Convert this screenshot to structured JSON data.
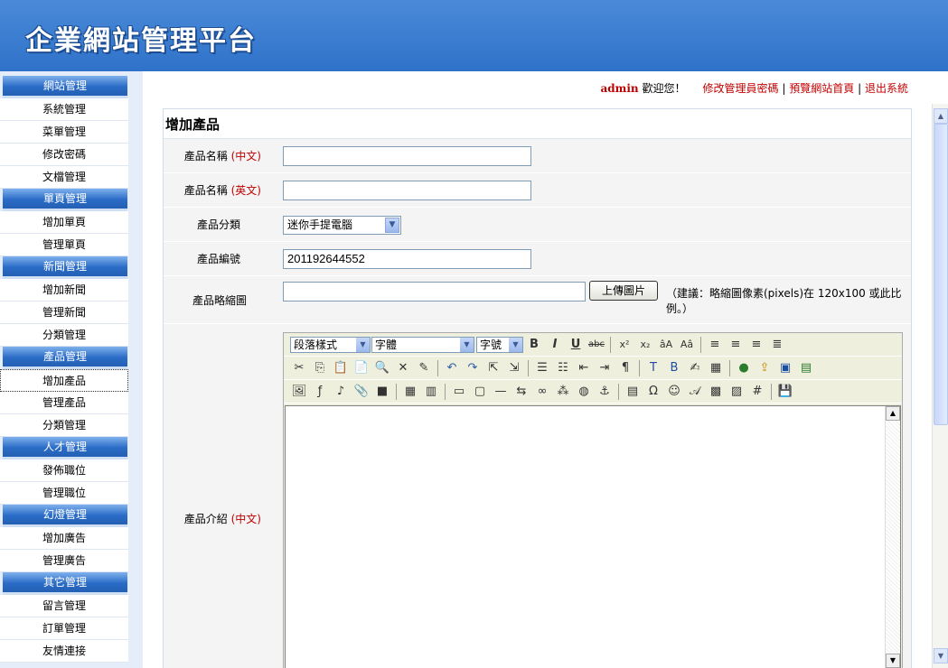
{
  "header": {
    "title": "企業網站管理平台"
  },
  "sidebar": {
    "groups": [
      {
        "head": "網站管理",
        "items": [
          "系統管理",
          "菜單管理",
          "修改密碼",
          "文檔管理"
        ]
      },
      {
        "head": "單頁管理",
        "items": [
          "增加單頁",
          "管理單頁"
        ]
      },
      {
        "head": "新聞管理",
        "items": [
          "增加新聞",
          "管理新聞",
          "分類管理"
        ]
      },
      {
        "head": "產品管理",
        "items": [
          "增加產品",
          "管理產品",
          "分類管理"
        ]
      },
      {
        "head": "人才管理",
        "items": [
          "發佈職位",
          "管理職位"
        ]
      },
      {
        "head": "幻燈管理",
        "items": [
          "增加廣告",
          "管理廣告"
        ]
      },
      {
        "head": "其它管理",
        "items": [
          "留言管理",
          "訂單管理",
          "友情連接"
        ]
      }
    ],
    "active_item": "增加產品"
  },
  "topbar": {
    "user": "admin",
    "welcome": "歡迎您！",
    "link_password": "修改管理員密碼",
    "sep1": "|",
    "link_preview": "預覽網站首頁",
    "sep2": "|",
    "link_logout": "退出系統"
  },
  "form": {
    "title": "增加產品",
    "name_cn_label": "產品名稱",
    "name_cn_tag": "(中文)",
    "name_cn_value": "",
    "name_en_label": "產品名稱",
    "name_en_tag": "(英文)",
    "name_en_value": "",
    "category_label": "產品分類",
    "category_value": "迷你手提電腦",
    "number_label": "產品編號",
    "number_value": "201192644552",
    "thumb_label": "產品略縮圖",
    "thumb_value": "",
    "upload_button": "上傳圖片",
    "thumb_hint": "（建議：略縮圖像素(pixels)在 120x100 或此比例。）",
    "intro_label": "產品介紹",
    "intro_tag": "(中文)"
  },
  "editor": {
    "format_select": "段落樣式",
    "font_select": "字體",
    "size_select": "字號"
  }
}
